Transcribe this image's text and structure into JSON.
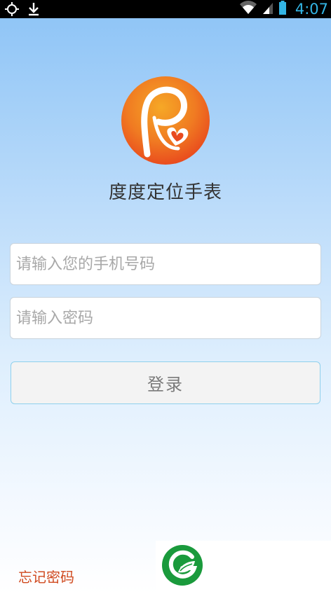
{
  "status_bar": {
    "time": "4:07",
    "icons": [
      "gps-icon",
      "download-icon",
      "wifi-icon",
      "signal-icon",
      "battery-icon"
    ]
  },
  "app": {
    "title": "度度定位手表",
    "logo_colors": {
      "orange": "#f39a1f",
      "red": "#e9421d"
    }
  },
  "login": {
    "phone_placeholder": "请输入您的手机号码",
    "phone_value": "",
    "password_placeholder": "请输入密码",
    "password_value": "",
    "login_label": "登录",
    "forgot_label": "忘记密码"
  },
  "colors": {
    "status_accent": "#33b5e5",
    "forgot_link": "#d04a1f",
    "brand_green": "#1a9a3c"
  }
}
